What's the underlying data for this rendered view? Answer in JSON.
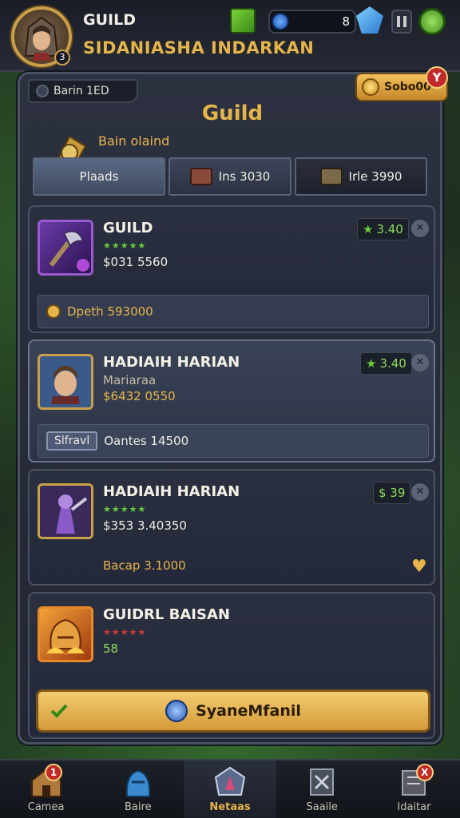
{
  "header": {
    "player_name": "GUILD",
    "player_title": "SIDANIASHA INDARKAN",
    "avatar_level": "3",
    "resource_value": "8"
  },
  "panel": {
    "tab_label": "Barin 1ED",
    "coin_button": "Sobo00",
    "notification": "Y",
    "title": "Guild",
    "emblem_text": "Bain olaind",
    "stat_tabs": [
      {
        "label": "Plaads"
      },
      {
        "label": "Ins 3030"
      },
      {
        "label": "Irle 3990"
      }
    ]
  },
  "cards": [
    {
      "name": "GUILD",
      "stars": "★★★★★",
      "value": "$031 5560",
      "score": "3.40",
      "footer_text": "Dpeth 593000"
    },
    {
      "name": "HADIAIH HARIAN",
      "sub": "Mariaraa",
      "value": "$6432 0550",
      "score": "3.40",
      "footer_badge": "Slfravl",
      "footer_text": "Oantes 14500"
    },
    {
      "name": "HADIAIH HARIAN",
      "stars": "★★★★★",
      "value": "$353 3.40350",
      "score": "$ 39",
      "footer_text": "Bacap 3.1000"
    },
    {
      "name": "GUIDRL BAISAN",
      "stars": "★★★★★",
      "value": "58"
    }
  ],
  "action_button": {
    "label": "SyaneMfanil"
  },
  "bottom_nav": [
    {
      "label": "Camea",
      "badge": "1"
    },
    {
      "label": "Baire",
      "badge": ""
    },
    {
      "label": "Netaas",
      "badge": ""
    },
    {
      "label": "Saaile",
      "badge": ""
    },
    {
      "label": "Idaitar",
      "badge": "X"
    }
  ],
  "colors": {
    "accent": "#e6b54a",
    "score_green": "#8fdc5a",
    "notif_red": "#c22a2a"
  }
}
